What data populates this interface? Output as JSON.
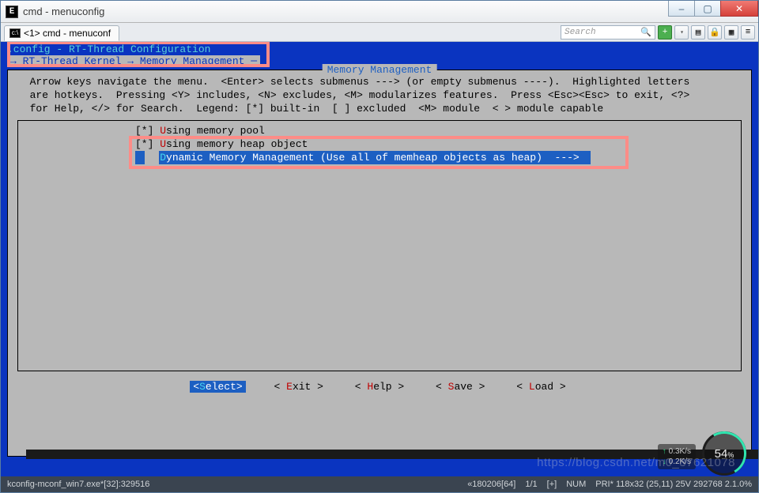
{
  "window": {
    "title": "cmd - menuconfig",
    "app_icon_text": "E"
  },
  "tab": {
    "icon_text": "c:\\",
    "label": "<1> cmd - menuconf"
  },
  "search": {
    "placeholder": "Search"
  },
  "toolbar_icons": {
    "add": "+",
    "menu": "▾",
    "opts": "▤",
    "lock": "🔒",
    "grid": "▦",
    "list": "≡"
  },
  "config_header": ".config - RT-Thread Configuration",
  "breadcrumb": "→ RT-Thread Kernel → Memory Management ─",
  "panel_title": "Memory Management",
  "help_lines": "  Arrow keys navigate the menu.  <Enter> selects submenus ---> (or empty submenus ----).  Highlighted letters\n  are hotkeys.  Pressing <Y> includes, <N> excludes, <M> modularizes features.  Press <Esc><Esc> to exit, <?>\n  for Help, </> for Search.  Legend: [*] built-in  [ ] excluded  <M> module  < > module capable",
  "menu": {
    "item0": {
      "prefix": "[*] ",
      "hot": "U",
      "rest": "sing memory pool"
    },
    "item1": {
      "prefix": "[*] ",
      "hot": "U",
      "rest": "sing memory heap object"
    },
    "item2": {
      "prefix": "    ",
      "hot": "D",
      "rest": "ynamic Memory Management (Use all of memheap objects as heap)  --->"
    }
  },
  "buttons": {
    "select": {
      "open": "<",
      "hot": "S",
      "rest": "elect>",
      "close": ""
    },
    "exit": {
      "open": "< ",
      "hot": "E",
      "rest": "xit >"
    },
    "help": {
      "open": "< ",
      "hot": "H",
      "rest": "elp >"
    },
    "save": {
      "open": "< ",
      "hot": "S",
      "rest": "ave >"
    },
    "load": {
      "open": "< ",
      "hot": "L",
      "rest": "oad >"
    }
  },
  "status": {
    "left": "kconfig-mconf_win7.exe*[32]:329516",
    "enc": "«180206[64]",
    "pos": "1/1",
    "ins": "[+]",
    "num": "NUM",
    "prs": "PRI*  118x32   (25,11) 25V  292768 2.1.0%"
  },
  "net": {
    "up": "0.3K/s",
    "down": "0.2K/s"
  },
  "gauge": {
    "value": "54",
    "suffix": "%"
  },
  "watermark": "https://blog.csdn.net/m0_37621078"
}
